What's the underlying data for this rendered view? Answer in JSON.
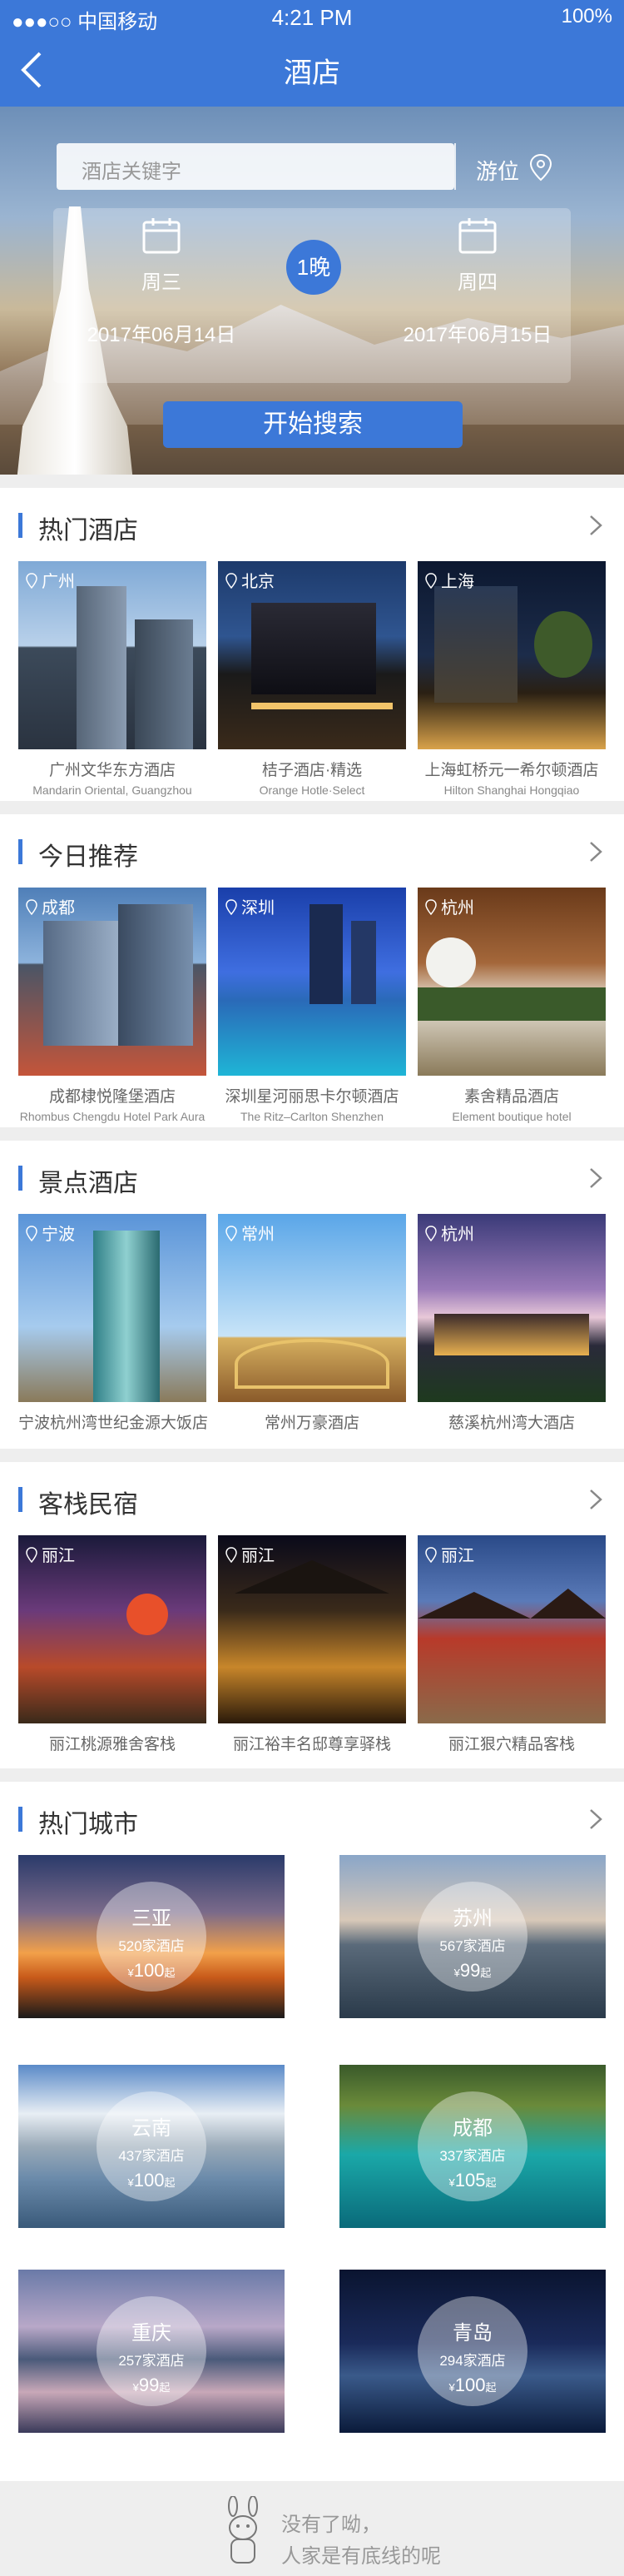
{
  "status": {
    "carrier": "●●●○○ 中国移动",
    "time": "4:21 PM",
    "battery": "100%"
  },
  "nav": {
    "title": "酒店"
  },
  "search": {
    "placeholder": "酒店关键字",
    "locate_label": "游位"
  },
  "dates": {
    "checkin_weekday": "周三",
    "checkin_date": "2017年06月14日",
    "nights": "1晚",
    "checkout_weekday": "周四",
    "checkout_date": "2017年06月15日"
  },
  "search_button": "开始搜索",
  "hot_hotels": {
    "title": "热门酒店",
    "items": [
      {
        "city": "广州",
        "name": "广州文华东方酒店",
        "en": "Mandarin Oriental, Guangzhou"
      },
      {
        "city": "北京",
        "name": "桔子酒店·精选",
        "en": "Orange Hotle·Select"
      },
      {
        "city": "上海",
        "name": "上海虹桥元一希尔顿酒店",
        "en": "Hilton Shanghai Hongqiao"
      }
    ]
  },
  "today": {
    "title": "今日推荐",
    "items": [
      {
        "city": "成都",
        "name": "成都棣悦隆堡酒店",
        "en": "Rhombus Chengdu Hotel Park Aura"
      },
      {
        "city": "深圳",
        "name": "深圳星河丽思卡尔顿酒店",
        "en": "The Ritz–Carlton Shenzhen"
      },
      {
        "city": "杭州",
        "name": "素舍精品酒店",
        "en": "Element boutique hotel"
      }
    ]
  },
  "scenic": {
    "title": "景点酒店",
    "items": [
      {
        "city": "宁波",
        "name": "宁波杭州湾世纪金源大饭店"
      },
      {
        "city": "常州",
        "name": "常州万豪酒店"
      },
      {
        "city": "杭州",
        "name": "慈溪杭州湾大酒店"
      }
    ]
  },
  "inns": {
    "title": "客栈民宿",
    "items": [
      {
        "city": "丽江",
        "name": "丽江桃源雅舍客栈"
      },
      {
        "city": "丽江",
        "name": "丽江裕丰名邸尊享驿栈"
      },
      {
        "city": "丽江",
        "name": "丽江狠穴精品客栈"
      }
    ]
  },
  "hot_cities": {
    "title": "热门城市",
    "items": [
      {
        "name": "三亚",
        "count": "520家酒店",
        "currency": "¥",
        "price": "100",
        "suffix": "起"
      },
      {
        "name": "苏州",
        "count": "567家酒店",
        "currency": "¥",
        "price": "99",
        "suffix": "起"
      },
      {
        "name": "云南",
        "count": "437家酒店",
        "currency": "¥",
        "price": "100",
        "suffix": "起"
      },
      {
        "name": "成都",
        "count": "337家酒店",
        "currency": "¥",
        "price": "105",
        "suffix": "起"
      },
      {
        "name": "重庆",
        "count": "257家酒店",
        "currency": "¥",
        "price": "99",
        "suffix": "起"
      },
      {
        "name": "青岛",
        "count": "294家酒店",
        "currency": "¥",
        "price": "100",
        "suffix": "起"
      }
    ]
  },
  "footer": {
    "line1": "没有了呦，",
    "line2": "人家是有底线的呢"
  }
}
